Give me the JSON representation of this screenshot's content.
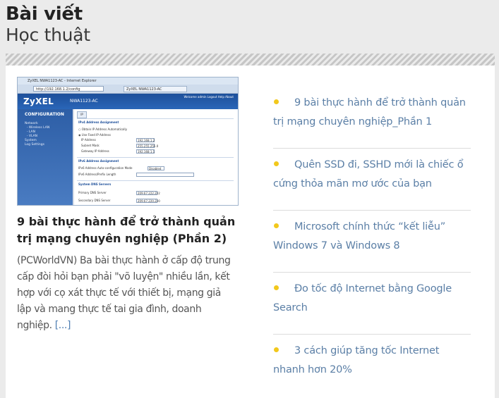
{
  "section": {
    "title": "Bài viết",
    "subtitle": "Học thuật"
  },
  "featured": {
    "title": "9 bài thực hành để trở thành quản trị mạng chuyên nghiệp (Phần 2)",
    "excerpt": "(PCWorldVN) Ba bài thực hành ở cấp độ trung cấp đòi hỏi bạn phải \"võ luyện\" nhiều lần, kết hợp với cọ xát thực tế với thiết bị, mạng giả lập và mang thực tế tai gia đình, doanh nghiệp.",
    "read_more": "[...]",
    "thumbnail": {
      "browser_title": "ZyXEL NWA1123-AC - Internet Explorer",
      "address": "http://192.168.1.2/config",
      "tab": "ZyXEL NWA1123-AC",
      "logo": "ZyXEL",
      "model": "NWA1123-AC",
      "welcome": "Welcome admin  Logout  Help  About",
      "sidebar_heading": "CONFIGURATION",
      "sidebar_nav": "Network\n  - Wireless LAN\n  - LAN\n  - VLAN\nSystem\nLog Settings",
      "tab_label": "IP",
      "ipv4_heading": "IPv4 Address Assignment",
      "opt_auto": "○ Obtain IP Address Automatically",
      "opt_fixed": "◉ Use Fixed IP Address",
      "ip_label": "IP Address",
      "ip_value": "192.168.1.2",
      "mask_label": "Subnet Mask",
      "mask_value": "255.255.255.0",
      "gw_label": "Gateway IP Address",
      "gw_value": "192.168.1.1",
      "ipv6_heading": "IPv6 Address Assignment",
      "ipv6_auto_label": "IPv6 Address Auto-configuration Mode",
      "ipv6_auto_value": "Disabled",
      "ipv6_prefix_label": "IPv6 Address/Prefix Length",
      "dns_heading": "System DNS Servers",
      "dns1_label": "Primary DNS Server",
      "dns1_value": "209.67.222.222",
      "dns2_label": "Secondary DNS Server",
      "dns2_value": "209.67.220.220"
    }
  },
  "related": [
    {
      "title": "9 bài thực hành để trở thành quản trị mạng chuyên nghiệp_Phần 1"
    },
    {
      "title": "Quên SSD đi, SSHD mới là chiếc ổ cứng thỏa mãn mơ ước của bạn"
    },
    {
      "title": "Microsoft chính thức “kết liễu” Windows 7 và Windows 8"
    },
    {
      "title": "Đo tốc độ Internet bằng Google Search"
    },
    {
      "title": "3 cách giúp tăng tốc Internet nhanh hơn 20%"
    }
  ],
  "colors": {
    "accent_bullet": "#f2c81c",
    "link": "#5b7fa6"
  }
}
